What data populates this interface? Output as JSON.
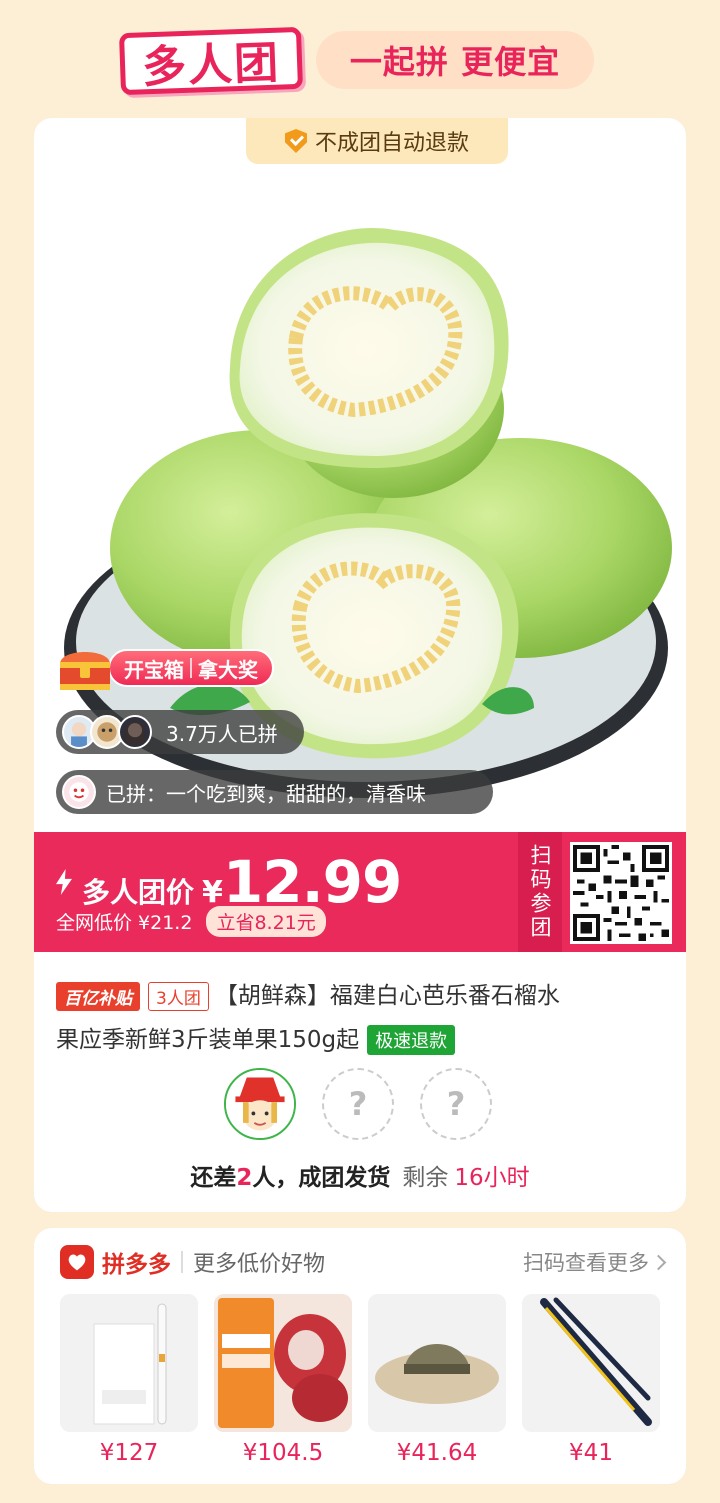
{
  "header": {
    "logo_text": "多人团",
    "slogan": "一起拼 更便宜"
  },
  "product": {
    "refund_tag": "不成团自动退款",
    "treasure_left": "开宝箱",
    "treasure_right": "拿大奖",
    "buyers_count": "3.7万人已拼",
    "review": "已拼：一个吃到爽，甜甜的，清香味",
    "price_label": "多人团价",
    "currency": "¥",
    "price": "12.99",
    "orig_price": "全网低价 ¥21.2",
    "save_text": "立省8.21元",
    "scan_label": "扫码参团",
    "tag_subsidy": "百亿补贴",
    "tag_group": "3人团",
    "title_line1": "【胡鲜森】福建白心芭乐番石榴水",
    "title_line2": "果应季新鲜3斤装单果150g起",
    "tag_refund_fast": "极速退款",
    "slot_placeholder": "?",
    "status_prefix": "还差",
    "status_count": "2",
    "status_suffix": "人，成团发货",
    "remaining_label": "剩余",
    "remaining_time": "16小时"
  },
  "more": {
    "brand": "拼多多",
    "title": "更多低价好物",
    "link": "扫码查看更多",
    "items": [
      {
        "price": "¥127",
        "icon": "toothbrush-product"
      },
      {
        "price": "¥104.5",
        "icon": "meat-product"
      },
      {
        "price": "¥41.64",
        "icon": "hat-product"
      },
      {
        "price": "¥41",
        "icon": "wiper-product"
      }
    ]
  },
  "colors": {
    "accent": "#e8245b",
    "page_bg": "#fdefd6",
    "green": "#1fa536"
  }
}
